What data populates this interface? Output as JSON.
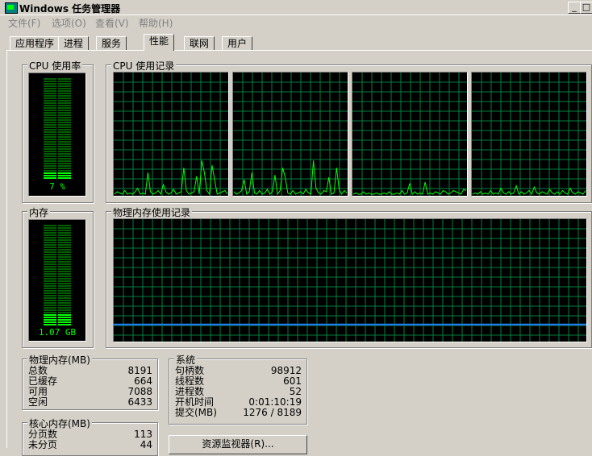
{
  "window": {
    "title": "Windows 任务管理器"
  },
  "menu": [
    "文件(F)",
    "选项(O)",
    "查看(V)",
    "帮助(H)"
  ],
  "tabs": [
    {
      "label": "应用程序",
      "active": false
    },
    {
      "label": "进程",
      "active": false
    },
    {
      "label": "服务",
      "active": false
    },
    {
      "label": "性能",
      "active": true
    },
    {
      "label": "联网",
      "active": false
    },
    {
      "label": "用户",
      "active": false
    }
  ],
  "cpu": {
    "usage_label": "CPU 使用率",
    "usage_text": "7 %",
    "usage_percent": 7,
    "history_label": "CPU 使用记录",
    "cores": [
      [
        0,
        2,
        1,
        0,
        3,
        0,
        1,
        0,
        2,
        5,
        0,
        1,
        0,
        18,
        2,
        0,
        1,
        3,
        0,
        8,
        2,
        0,
        1,
        4,
        0,
        1,
        2,
        22,
        3,
        0,
        1,
        2,
        15,
        0,
        28,
        18,
        3,
        0,
        24,
        12,
        0,
        1,
        2,
        3,
        0
      ],
      [
        2,
        0,
        1,
        3,
        12,
        0,
        2,
        18,
        1,
        0,
        3,
        0,
        1,
        4,
        0,
        2,
        16,
        0,
        3,
        22,
        14,
        1,
        0,
        3,
        0,
        1,
        2,
        0,
        4,
        1,
        0,
        28,
        5,
        1,
        0,
        3,
        2,
        14,
        0,
        1,
        22,
        4,
        0,
        3,
        1
      ],
      [
        0,
        1,
        0,
        0,
        2,
        0,
        1,
        0,
        0,
        1,
        0,
        0,
        1,
        0,
        2,
        0,
        0,
        1,
        0,
        3,
        0,
        1,
        9,
        0,
        2,
        0,
        1,
        0,
        10,
        0,
        1,
        0,
        2,
        1,
        0,
        3,
        2,
        0,
        1,
        3,
        2,
        1,
        0,
        4,
        3
      ],
      [
        0,
        1,
        0,
        2,
        0,
        1,
        0,
        3,
        0,
        1,
        0,
        5,
        1,
        0,
        2,
        0,
        1,
        7,
        0,
        2,
        0,
        1,
        3,
        0,
        6,
        1,
        0,
        2,
        1,
        0,
        4,
        1,
        0,
        2,
        0,
        3,
        1,
        0,
        5,
        1,
        0,
        2,
        1,
        0,
        3
      ]
    ]
  },
  "memory": {
    "usage_label": "内存",
    "usage_text": "1.07 GB",
    "usage_fraction": 0.13,
    "history_label": "物理内存使用记录",
    "history_fraction": 0.13
  },
  "physical": {
    "label": "物理内存(MB)",
    "rows": [
      {
        "name": "总数",
        "value": "8191"
      },
      {
        "name": "已缓存",
        "value": "664"
      },
      {
        "name": "可用",
        "value": "7088"
      },
      {
        "name": "空闲",
        "value": "6433"
      }
    ]
  },
  "kernel": {
    "label": "核心内存(MB)",
    "rows": [
      {
        "name": "分页数",
        "value": "113"
      },
      {
        "name": "未分页",
        "value": "44"
      }
    ]
  },
  "system": {
    "label": "系统",
    "rows": [
      {
        "name": "句柄数",
        "value": "98912"
      },
      {
        "name": "线程数",
        "value": "601"
      },
      {
        "name": "进程数",
        "value": "52"
      },
      {
        "name": "开机时间",
        "value": "0:01:10:19"
      },
      {
        "name": "提交(MB)",
        "value": "1276 / 8189"
      }
    ]
  },
  "buttons": {
    "resource_monitor": "资源监视器(R)..."
  },
  "colors": {
    "graph_grid": "#008040",
    "cpu_line": "#00ff00",
    "mem_line": "#1f7fff",
    "meter_on": "#00ff00",
    "meter_off": "#006000"
  }
}
